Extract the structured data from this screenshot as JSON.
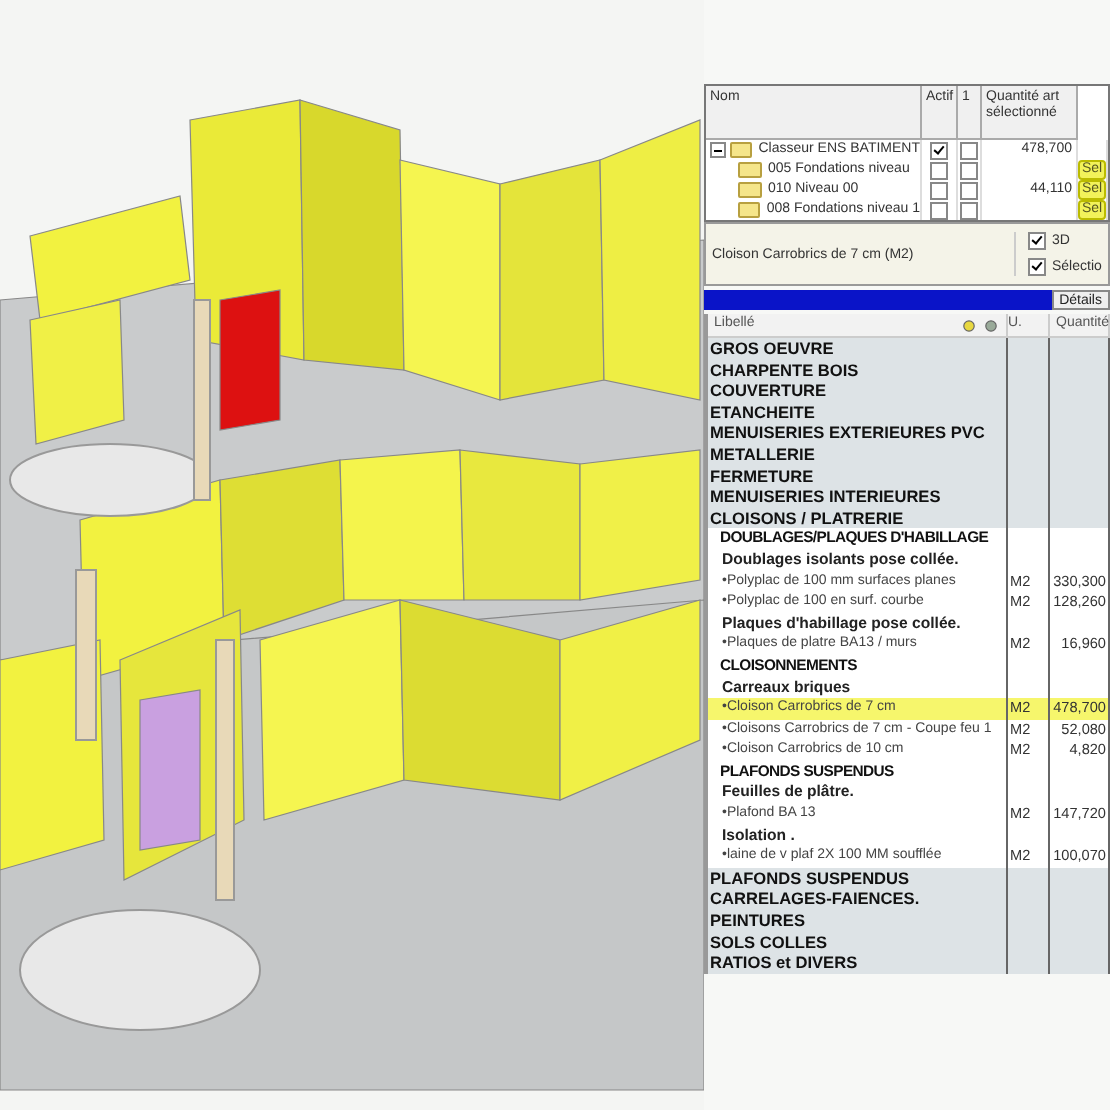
{
  "tree": {
    "columns": [
      "Nom",
      "Actif",
      "1",
      "Quantité art sélectionné"
    ],
    "nodes": [
      {
        "name": "Classeur ENS BATIMENT",
        "expanded": true,
        "actif": true,
        "col_1": false,
        "quantity": "478,700",
        "children": [
          {
            "name": "005 Fondations niveau",
            "actif": false,
            "col_1": false,
            "sel": "Sel"
          },
          {
            "name": "010 Niveau 00",
            "actif": false,
            "col_1": false,
            "quantity": "44,110",
            "sel": "Sel"
          },
          {
            "name": "008 Fondations niveau 1",
            "actif": false,
            "col_1": false,
            "sel": "Sel"
          }
        ]
      }
    ]
  },
  "selection": {
    "label": "Cloison Carrobrics de 7 cm  (M2)",
    "options": [
      {
        "label": "3D",
        "checked": true
      },
      {
        "label": "Sélectio",
        "checked": true
      }
    ]
  },
  "toolbar": {
    "button": "Détails"
  },
  "table": {
    "columns": [
      "Libellé",
      "U.",
      "Quantité"
    ],
    "rows": [
      {
        "kind": "category",
        "label": "GROS OEUVRE"
      },
      {
        "kind": "category",
        "label": "CHARPENTE BOIS"
      },
      {
        "kind": "category",
        "label": "COUVERTURE"
      },
      {
        "kind": "category",
        "label": "ETANCHEITE"
      },
      {
        "kind": "category",
        "label": "MENUISERIES EXTERIEURES PVC"
      },
      {
        "kind": "category",
        "label": "METALLERIE"
      },
      {
        "kind": "category",
        "label": "FERMETURE"
      },
      {
        "kind": "category",
        "label": "MENUISERIES INTERIEURES"
      },
      {
        "kind": "category",
        "label": "CLOISONS / PLATRERIE",
        "children": [
          {
            "kind": "group",
            "label": "DOUBLAGES/PLAQUES D'HABILLAGE",
            "children": [
              {
                "kind": "subgroup",
                "label": "Doublages isolants pose collée.",
                "children": [
                  {
                    "kind": "item",
                    "label": "•Polyplac de 100 mm surfaces planes",
                    "unit": "M2",
                    "quantity": "330,300",
                    "selected": false
                  },
                  {
                    "kind": "item",
                    "label": "•Polyplac de 100 en surf. courbe",
                    "unit": "M2",
                    "quantity": "128,260",
                    "selected": false
                  }
                ]
              },
              {
                "kind": "subgroup",
                "label": "Plaques d'habillage pose collée.",
                "children": [
                  {
                    "kind": "item",
                    "label": "•Plaques de platre BA13 / murs",
                    "unit": "M2",
                    "quantity": "16,960",
                    "selected": false
                  }
                ]
              }
            ]
          },
          {
            "kind": "group",
            "label": "CLOISONNEMENTS",
            "children": [
              {
                "kind": "subgroup",
                "label": "Carreaux briques",
                "children": [
                  {
                    "kind": "item",
                    "label": "•Cloison Carrobrics de 7 cm",
                    "unit": "M2",
                    "quantity": "478,700",
                    "selected": true
                  },
                  {
                    "kind": "item",
                    "label": "•Cloisons Carrobrics de 7 cm - Coupe feu 1",
                    "unit": "M2",
                    "quantity": "52,080",
                    "selected": false
                  },
                  {
                    "kind": "item",
                    "label": "•Cloison Carrobrics de 10 cm",
                    "unit": "M2",
                    "quantity": "4,820",
                    "selected": false
                  }
                ]
              }
            ]
          },
          {
            "kind": "group",
            "label": "PLAFONDS SUSPENDUS",
            "children": [
              {
                "kind": "subgroup",
                "label": "Feuilles de plâtre.",
                "children": [
                  {
                    "kind": "item",
                    "label": "•Plafond BA 13",
                    "unit": "M2",
                    "quantity": "147,720",
                    "selected": false
                  }
                ]
              },
              {
                "kind": "subgroup",
                "label": "Isolation .",
                "children": [
                  {
                    "kind": "item",
                    "label": "•laine de v plaf 2X 100 MM soufflée",
                    "unit": "M2",
                    "quantity": "100,070",
                    "selected": false
                  }
                ]
              }
            ]
          }
        ]
      },
      {
        "kind": "category",
        "label": "PLAFONDS SUSPENDUS"
      },
      {
        "kind": "category",
        "label": "CARRELAGES-FAIENCES."
      },
      {
        "kind": "category",
        "label": "PEINTURES"
      },
      {
        "kind": "category",
        "label": "SOLS COLLES"
      },
      {
        "kind": "category",
        "label": "RATIOS et DIVERS"
      }
    ]
  }
}
